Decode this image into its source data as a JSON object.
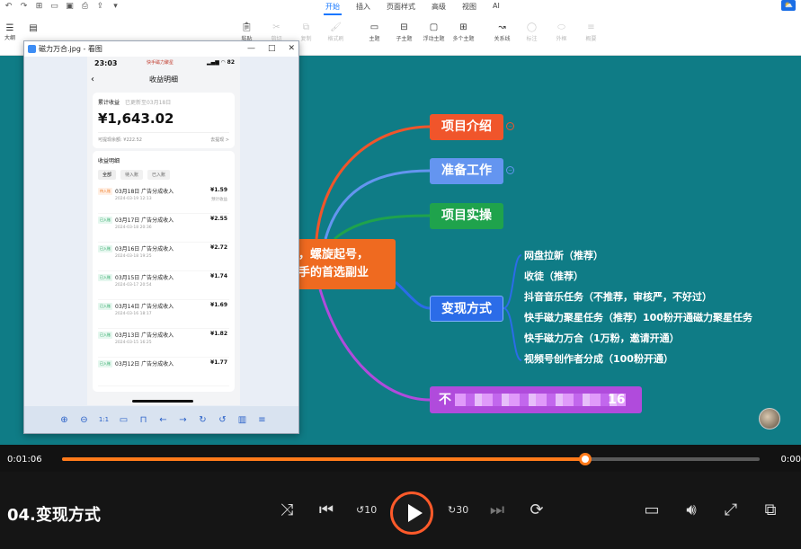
{
  "app": {
    "menu_tabs": [
      {
        "label": "开始",
        "active": true
      },
      {
        "label": "插入",
        "active": false
      },
      {
        "label": "页面样式",
        "active": false
      },
      {
        "label": "高级",
        "active": false
      },
      {
        "label": "视图",
        "active": false
      },
      {
        "label": "AI",
        "active": false
      }
    ],
    "left_panel": {
      "outline_label": "大纲"
    },
    "toolbar": [
      {
        "label": "粘贴",
        "icon": "paste-icon",
        "dim": false
      },
      {
        "label": "剪切",
        "icon": "cut-icon",
        "dim": true
      },
      {
        "label": "复制",
        "icon": "copy-icon",
        "dim": true
      },
      {
        "label": "格式刷",
        "icon": "format-brush-icon",
        "dim": true
      },
      {
        "label": "主题",
        "icon": "topic-icon",
        "dim": false
      },
      {
        "label": "子主题",
        "icon": "subtopic-icon",
        "dim": false
      },
      {
        "label": "浮动主题",
        "icon": "floating-topic-icon",
        "dim": false
      },
      {
        "label": "多个主题",
        "icon": "multi-topic-icon",
        "dim": false
      },
      {
        "label": "关系线",
        "icon": "relation-icon",
        "dim": false
      },
      {
        "label": "标注",
        "icon": "callout-icon",
        "dim": true
      },
      {
        "label": "外框",
        "icon": "boundary-icon",
        "dim": true
      },
      {
        "label": "概要",
        "icon": "summary-icon",
        "dim": true
      }
    ]
  },
  "mindmap": {
    "center_line1": "，螺旋起号，",
    "center_line2": "手的首选副业",
    "branches": {
      "intro": "项目介绍",
      "prep": "准备工作",
      "practice": "项目实操",
      "monetize": "变现方式",
      "last": "不"
    },
    "monetize_items": [
      "网盘拉新（推荐）",
      "收徒（推荐）",
      "抖音音乐任务（不推荐，审核严，不好过）",
      "快手磁力聚星任务（推荐）100粉开通磁力聚星任务",
      "快手磁力万合（1万粉，邀请开通）",
      "视频号创作者分成（100粉开通）"
    ],
    "last_tail": "16",
    "colors": {
      "intro": "#f0552b",
      "prep": "#6495f0",
      "practice": "#1fa34c",
      "monetize": "#2b6ce8",
      "last": "#b04bdc",
      "center": "#ef6a20"
    }
  },
  "viewer": {
    "title": "磁力万合.jpg - 看图",
    "phone": {
      "time": "23:03",
      "brand": "快手磁力聚星",
      "battery": "82",
      "page_title": "收益明细",
      "earnings": {
        "label": "累计收益",
        "updated": "已更新至03月18日",
        "amount": "¥1,643.02",
        "withdrawable": "可提现余额: ¥222.52",
        "withdraw_link": "去提现 >"
      },
      "detail_title": "收益明细",
      "tabs": [
        {
          "label": "全部",
          "on": true
        },
        {
          "label": "待入账",
          "on": false
        },
        {
          "label": "已入账",
          "on": false
        }
      ],
      "rows": [
        {
          "tag": "待入账",
          "status": "pend",
          "title": "03月18日 广告分成收入",
          "date": "2024-03-19 12:13",
          "amount": "¥1.59",
          "note": "预计收益"
        },
        {
          "tag": "已入账",
          "status": "done",
          "title": "03月17日 广告分成收入",
          "date": "2024-03-18 20:36",
          "amount": "¥2.55",
          "note": ""
        },
        {
          "tag": "已入账",
          "status": "done",
          "title": "03月16日 广告分成收入",
          "date": "2024-03-18 19:25",
          "amount": "¥2.72",
          "note": ""
        },
        {
          "tag": "已入账",
          "status": "done",
          "title": "03月15日 广告分成收入",
          "date": "2024-03-17 20:54",
          "amount": "¥1.74",
          "note": ""
        },
        {
          "tag": "已入账",
          "status": "done",
          "title": "03月14日 广告分成收入",
          "date": "2024-03-16 18:17",
          "amount": "¥1.69",
          "note": ""
        },
        {
          "tag": "已入账",
          "status": "done",
          "title": "03月13日 广告分成收入",
          "date": "2024-03-15 16:25",
          "amount": "¥1.82",
          "note": ""
        },
        {
          "tag": "已入账",
          "status": "done",
          "title": "03月12日 广告分成收入",
          "date": "",
          "amount": "¥1.77",
          "note": ""
        }
      ]
    },
    "tools": [
      {
        "icon": "zoom-in-icon",
        "glyph": "⊕"
      },
      {
        "icon": "zoom-out-icon",
        "glyph": "⊖"
      },
      {
        "icon": "actual-size-icon",
        "glyph": "1:1"
      },
      {
        "icon": "open-folder-icon",
        "glyph": "▭"
      },
      {
        "icon": "slideshow-icon",
        "glyph": "⊓"
      },
      {
        "icon": "prev-image-icon",
        "glyph": "←"
      },
      {
        "icon": "next-image-icon",
        "glyph": "→"
      },
      {
        "icon": "rotate-right-icon",
        "glyph": "↻"
      },
      {
        "icon": "rotate-left-icon",
        "glyph": "↺"
      },
      {
        "icon": "delete-icon",
        "glyph": "▥"
      },
      {
        "icon": "menu-icon",
        "glyph": "≡"
      }
    ]
  },
  "player": {
    "current_time": "0:01:06",
    "end_time": "0:00",
    "progress": 0.75,
    "video_title": "04.变现方式",
    "accent": "#ff7a1a",
    "rewind_label": "10",
    "forward_label": "30"
  }
}
